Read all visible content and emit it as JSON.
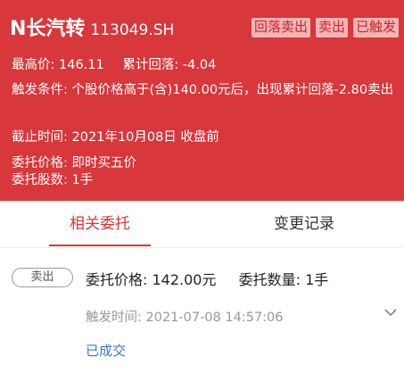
{
  "header": {
    "stock_name": "N长汽转",
    "stock_code": "113049.SH",
    "tags": [
      "回落卖出",
      "卖出",
      "已触发"
    ],
    "high_label": "最高价:",
    "high_value": "146.11",
    "retrace_label": "累计回落:",
    "retrace_value": "-4.04",
    "condition_label": "触发条件:",
    "condition_text": "个股价格高于(含)140.00元后，出现累计回落-2.80卖出",
    "deadline_label": "截止时间:",
    "deadline_value": "2021年10月08日 收盘前",
    "order_price_label": "委托价格:",
    "order_price_value": "即时买五价",
    "order_qty_label": "委托股数:",
    "order_qty_value": "1手"
  },
  "tabs": {
    "active": "相关委托",
    "inactive": "变更记录"
  },
  "record": {
    "side": "卖出",
    "price_label": "委托价格:",
    "price_value": "142.00元",
    "qty_label": "委托数量:",
    "qty_value": "1手",
    "time_label": "触发时间:",
    "time_value": "2021-07-08 14:57:06",
    "status": "已成交"
  },
  "colors": {
    "header_bg": "#d8373b",
    "accent": "#d8373b",
    "status_link": "#3a78c9"
  }
}
